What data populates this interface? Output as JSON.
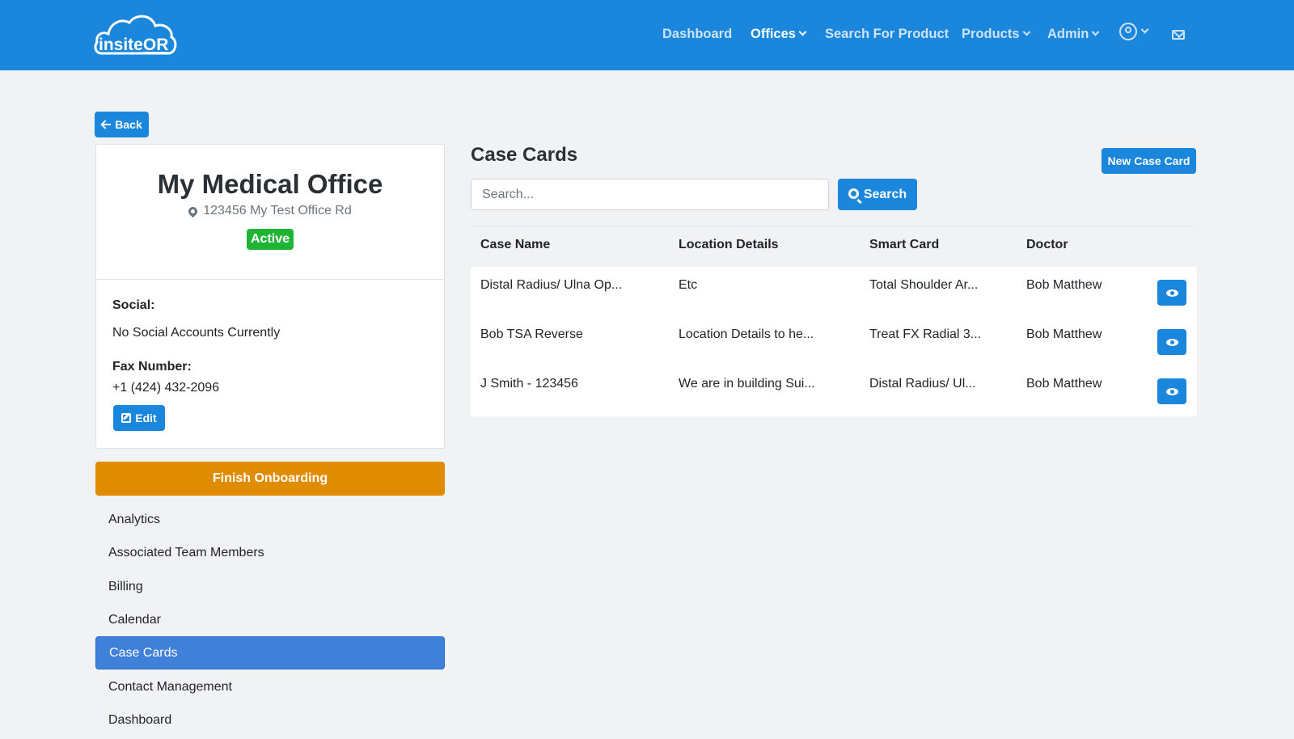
{
  "brand": {
    "logo_text_a": "insite",
    "logo_text_b": "OR"
  },
  "nav": {
    "items": [
      {
        "label": "Dashboard"
      },
      {
        "label": "Offices"
      },
      {
        "label": "Search For Product"
      },
      {
        "label": "Products"
      },
      {
        "label": "Admin"
      }
    ]
  },
  "back_label": "Back",
  "office": {
    "name": "My Medical Office",
    "address": "123456 My Test Office Rd",
    "status": "Active",
    "social_label": "Social:",
    "social_value": "No Social Accounts Currently",
    "fax_label": "Fax Number:",
    "fax_value": "+1 (424) 432-2096",
    "edit_label": "Edit"
  },
  "onboarding_label": "Finish Onboarding",
  "sidebar": {
    "items": [
      {
        "label": "Analytics"
      },
      {
        "label": "Associated Team Members"
      },
      {
        "label": "Billing"
      },
      {
        "label": "Calendar"
      },
      {
        "label": "Case Cards"
      },
      {
        "label": "Contact Management"
      },
      {
        "label": "Dashboard"
      }
    ],
    "active": "Case Cards"
  },
  "main": {
    "title": "Case Cards",
    "new_label": "New Case Card",
    "search_placeholder": "Search...",
    "search_label": "Search",
    "columns": [
      "Case Name",
      "Location Details",
      "Smart Card",
      "Doctor"
    ],
    "rows": [
      {
        "case_name": "Distal Radius/ Ulna Op...",
        "location": "Etc",
        "smart_card": "Total Shoulder Ar...",
        "doctor": "Bob Matthew"
      },
      {
        "case_name": "Bob TSA Reverse",
        "location": "Location Details to he...",
        "smart_card": "Treat FX Radial 3...",
        "doctor": "Bob Matthew"
      },
      {
        "case_name": "J Smith - 123456",
        "location": "We are in building Sui...",
        "smart_card": "Distal Radius/ Ul...",
        "doctor": "Bob Matthew"
      }
    ]
  },
  "colors": {
    "primary": "#1a86dc",
    "success": "#20b436",
    "warning": "#e08c00",
    "active_nav": "#3f80d9"
  }
}
